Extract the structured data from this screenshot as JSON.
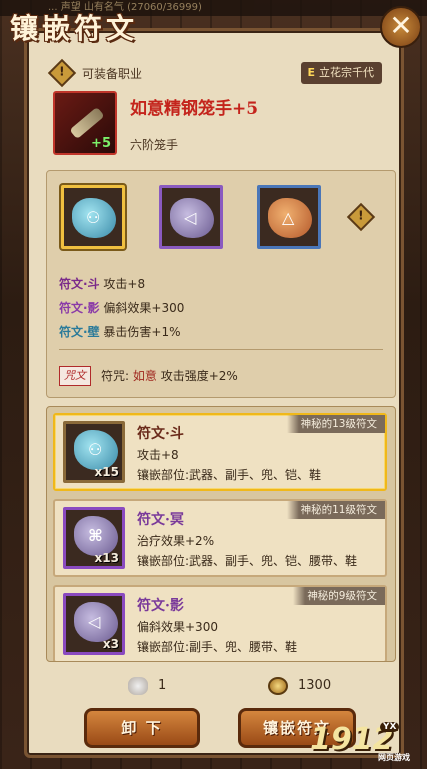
{
  "top_ticker": "... 声望 山有名气 (27060/36999)",
  "title": "镶嵌符文",
  "header": {
    "class_label": "可装备职业",
    "class_badge_letter": "E",
    "class_badge_name": "立花宗千代"
  },
  "item": {
    "name": "如意精钢笼手+5",
    "plus": "+5",
    "subtitle": "六阶笼手"
  },
  "sockets": [
    {
      "color": "teal",
      "selected": true
    },
    {
      "color": "purple",
      "selected": false
    },
    {
      "color": "orange",
      "selected": false
    }
  ],
  "socket_stats": [
    {
      "rune": "符文·斗",
      "effect": "攻击+8"
    },
    {
      "rune": "符文·影",
      "effect": "偏斜效果+300"
    },
    {
      "rune": "符文·壁",
      "effect": "暴击伤害+1%"
    }
  ],
  "curse": {
    "tag": "咒文",
    "label": "符咒:",
    "rune": "如意",
    "effect": "攻击强度+2%"
  },
  "rune_list": [
    {
      "name": "符文·斗",
      "tag": "神秘的13级符文",
      "count": "x15",
      "stat": "攻击+8",
      "slots": "镶嵌部位:武器、副手、兜、铠、鞋",
      "selected": true
    },
    {
      "name": "符文·冥",
      "tag": "神秘的11级符文",
      "count": "x13",
      "stat": "治疗效果+2%",
      "slots": "镶嵌部位:武器、副手、兜、铠、腰带、鞋",
      "selected": false
    },
    {
      "name": "符文·影",
      "tag": "神秘的9级符文",
      "count": "x3",
      "stat": "偏斜效果+300",
      "slots": "镶嵌部位:副手、兜、腰带、鞋",
      "selected": false
    }
  ],
  "currency": {
    "stone": "1",
    "coin": "1300"
  },
  "buttons": {
    "unequip": "卸 下",
    "inlay": "镶嵌符文"
  },
  "watermark": {
    "main": "1912",
    "badge": "YX",
    "sub": "网页游戏"
  }
}
